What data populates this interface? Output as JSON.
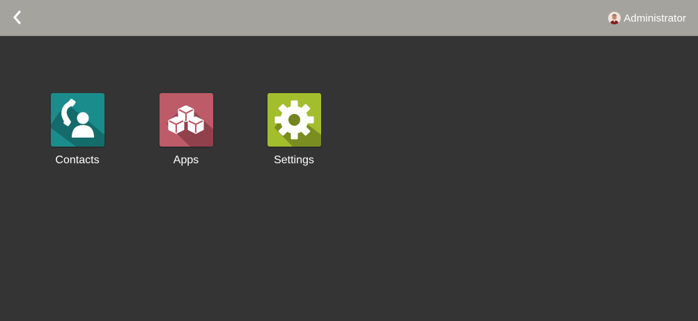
{
  "header": {
    "back_icon": "chevron-left-icon",
    "user": {
      "name": "Administrator",
      "avatar_icon": "user-avatar-icon"
    }
  },
  "apps": [
    {
      "label": "Contacts",
      "icon": "contacts-icon",
      "color": "#1b8c8c"
    },
    {
      "label": "Apps",
      "icon": "apps-cubes-icon",
      "color": "#bd5b68"
    },
    {
      "label": "Settings",
      "icon": "gear-icon",
      "color": "#a3be2c"
    }
  ]
}
